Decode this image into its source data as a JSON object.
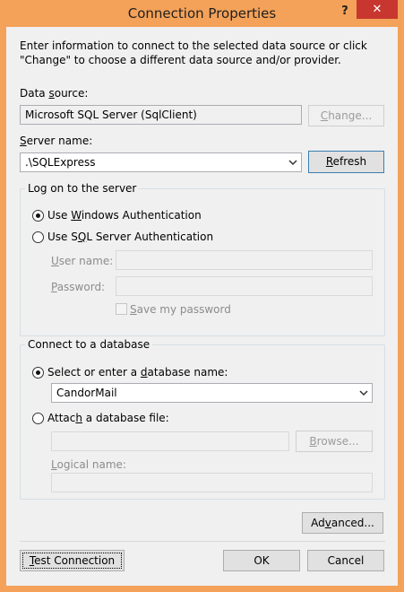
{
  "window": {
    "title": "Connection Properties",
    "help_label": "?",
    "close_label": "✕",
    "title_color": "#f4a259",
    "close_color": "#c7372f"
  },
  "intro": "Enter information to connect to the selected data source or click \"Change\" to choose a different data source and/or provider.",
  "data_source": {
    "label_pre": "Data ",
    "label_key": "s",
    "label_post": "ource:",
    "value": "Microsoft SQL Server (SqlClient)",
    "change_pre": "",
    "change_key": "C",
    "change_post": "hange..."
  },
  "server": {
    "label_pre": "",
    "label_key": "S",
    "label_post": "erver name:",
    "value": ".\\SQLExpress",
    "refresh_pre": "",
    "refresh_key": "R",
    "refresh_post": "efresh"
  },
  "logon": {
    "group_title": "Log on to the server",
    "windows_pre": "Use ",
    "windows_key": "W",
    "windows_post": "indows Authentication",
    "sql_pre": "Use S",
    "sql_key": "Q",
    "sql_post": "L Server Authentication",
    "username_pre": "",
    "username_key": "U",
    "username_post": "ser name:",
    "password_pre": "",
    "password_key": "P",
    "password_post": "assword:",
    "save_pre": "",
    "save_key": "S",
    "save_post": "ave my password"
  },
  "database": {
    "group_title": "Connect to a database",
    "select_pre": "Select or enter a ",
    "select_key": "d",
    "select_post": "atabase name:",
    "db_value": "CandorMail",
    "attach_pre": "Attac",
    "attach_key": "h",
    "attach_post": " a database file:",
    "browse_pre": "",
    "browse_key": "B",
    "browse_post": "rowse...",
    "logical_pre": "",
    "logical_key": "L",
    "logical_post": "ogical name:"
  },
  "buttons": {
    "advanced_pre": "Ad",
    "advanced_key": "v",
    "advanced_post": "anced...",
    "test_pre": "",
    "test_key": "T",
    "test_post": "est Connection",
    "ok": "OK",
    "cancel": "Cancel"
  }
}
